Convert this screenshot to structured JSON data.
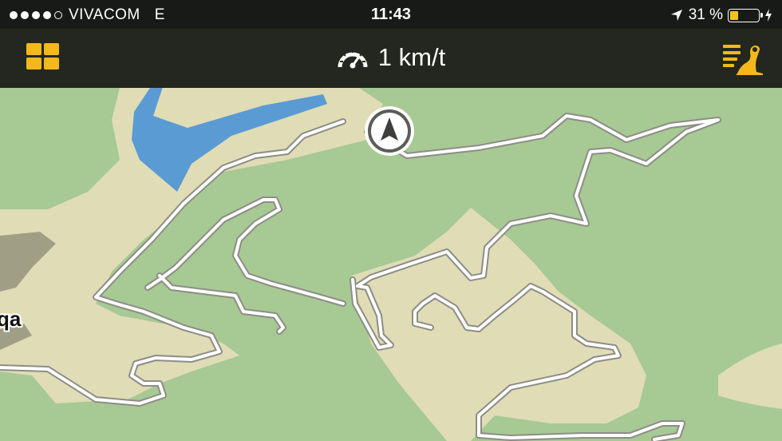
{
  "status_bar": {
    "carrier": "VIVACOM",
    "network": "E",
    "time": "11:43",
    "battery_percent": "31 %",
    "battery_level": 0.31,
    "signal_bars_filled": 4,
    "signal_bars_total": 5
  },
  "nav_bar": {
    "menu_icon": "grid-icon",
    "speed": "1 km/t",
    "speed_icon": "speedometer-icon",
    "route_icon": "route-list-icon"
  },
  "map": {
    "partial_place_label": "qa",
    "colors": {
      "forest": "#a7c994",
      "open_land": "#e0dcb6",
      "water": "#5b9bd3",
      "urban": "#a09f86",
      "road": "#ffffff",
      "road_casing": "#8d8d86",
      "accent": "#f4b81d"
    }
  }
}
